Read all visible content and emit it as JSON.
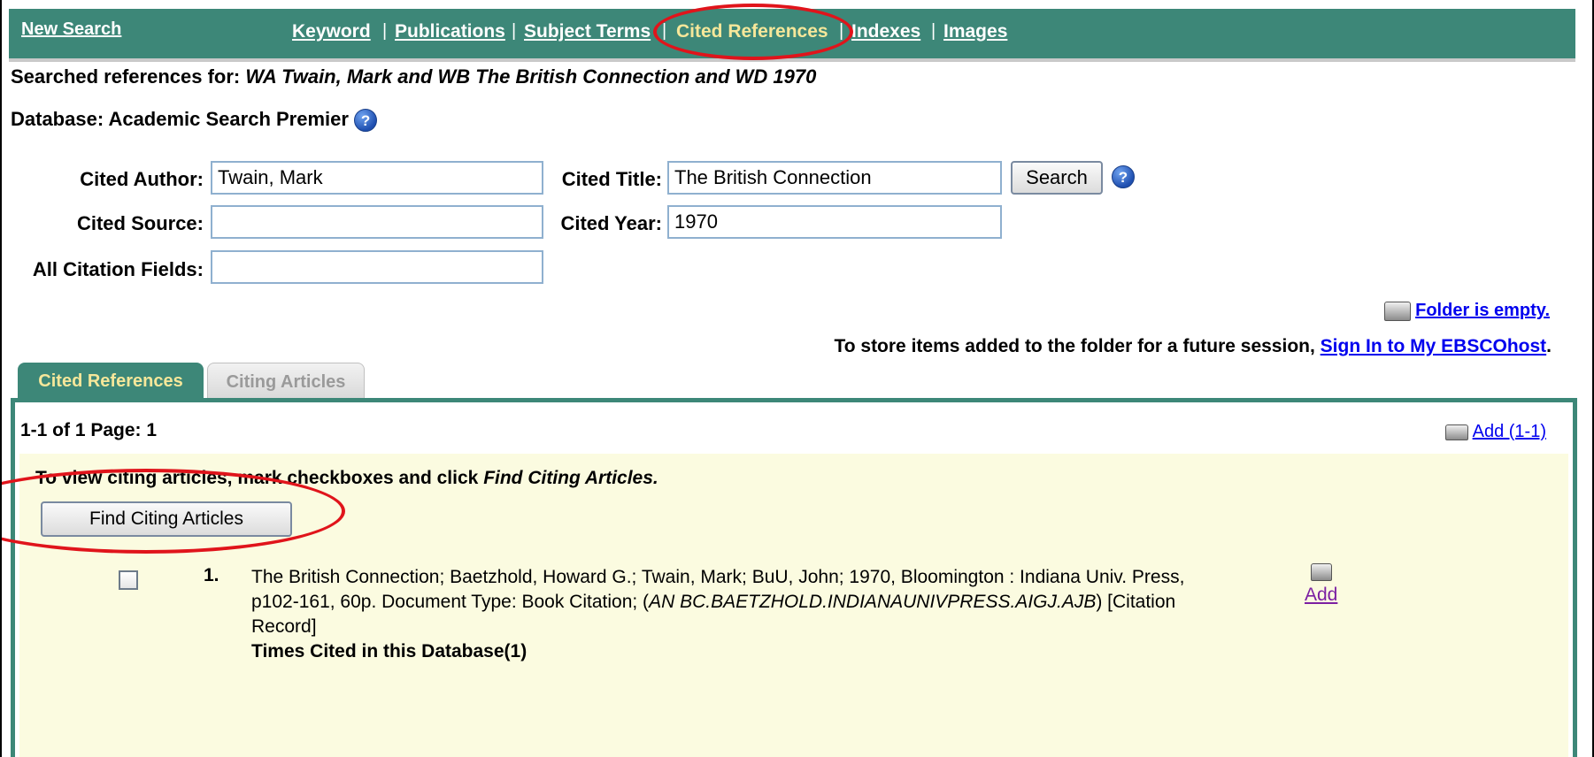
{
  "nav": {
    "new_search": "New Search",
    "links": [
      "Keyword",
      "Publications",
      "Subject Terms",
      "Cited References",
      "Indexes",
      "Images"
    ],
    "active": "Cited References"
  },
  "searched": {
    "prefix": "Searched references for:",
    "query": "WA Twain, Mark and WB The British Connection and WD 1970"
  },
  "database": {
    "label": "Database: Academic Search Premier"
  },
  "form": {
    "cited_author_label": "Cited Author:",
    "cited_author_value": "Twain, Mark",
    "cited_title_label": "Cited Title:",
    "cited_title_value": "The British Connection",
    "cited_source_label": "Cited Source:",
    "cited_source_value": "",
    "cited_year_label": "Cited Year:",
    "cited_year_value": "1970",
    "all_fields_label": "All Citation Fields:",
    "all_fields_value": "",
    "search_button": "Search"
  },
  "folder": {
    "status": "Folder is empty.",
    "store_text": "To store items added to the folder for a future session,",
    "sign_in": "Sign In to My EBSCOhost",
    "period": "."
  },
  "tabs": {
    "active": "Cited References",
    "inactive": "Citing Articles"
  },
  "results": {
    "count": "1-1 of 1 Page: 1",
    "add_range": "Add (1-1)",
    "instruction_prefix": "To view citing articles, mark checkboxes and click",
    "instruction_action": "Find Citing Articles.",
    "find_button": "Find Citing Articles",
    "item": {
      "number": "1.",
      "text_line1": "The British Connection; Baetzhold, Howard G.; Twain, Mark; BuU, John; 1970, Bloomington : Indiana Univ. Press,",
      "text_line2_a": "p102-161, 60p. Document Type: Book Citation; (",
      "text_line2_an": "AN BC.BAETZHOLD.INDIANAUNIVPRESS.AIGJ.AJB",
      "text_line2_b": ") [Citation",
      "text_line3": "Record]",
      "times_cited": "Times Cited in this Database(1)",
      "add": "Add"
    }
  },
  "colors": {
    "nav_bg": "#3d8778",
    "active_tab_text": "#f6e79a",
    "highlight": "#e0141b",
    "panel_bg": "#fbfbe0"
  }
}
